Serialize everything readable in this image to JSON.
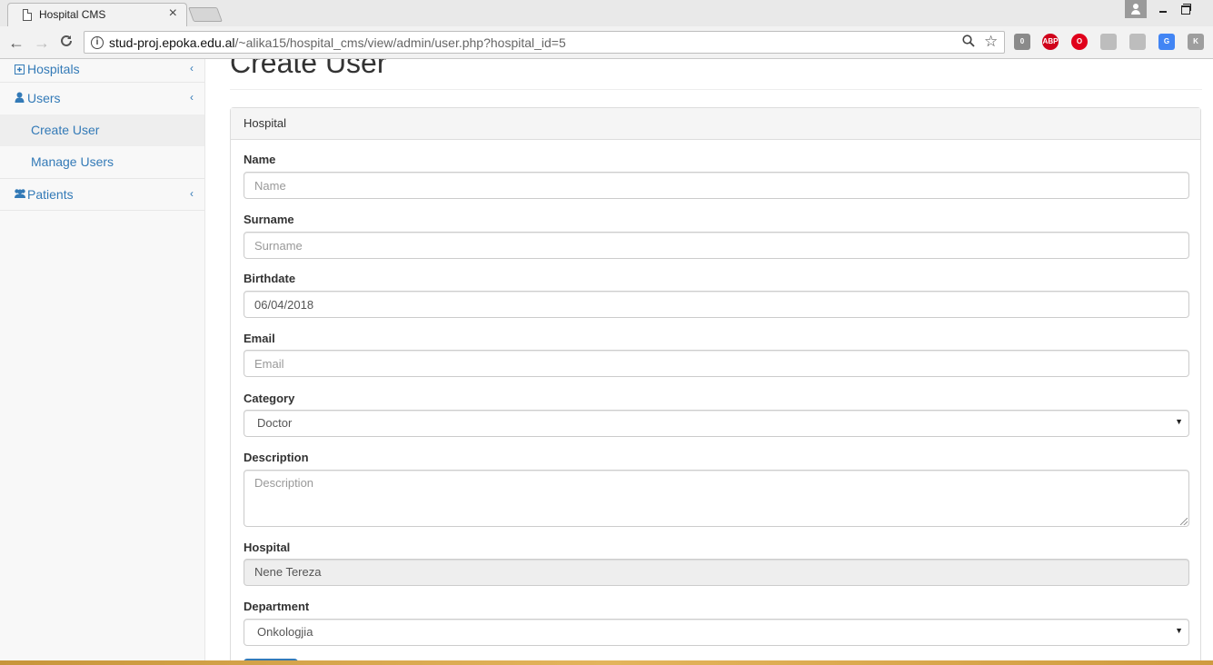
{
  "browser": {
    "tab_title": "Hospital CMS",
    "tab_close": "×",
    "url_host": "stud-proj.epoka.edu.al",
    "url_path": "/~alika15/hospital_cms/view/admin/user.php?hospital_id=5",
    "nav": {
      "back": "←",
      "forward": "→",
      "reload": "C"
    },
    "extensions": [
      {
        "name": "extension-badge-icon",
        "color": "#8a8a8a",
        "text": "0"
      },
      {
        "name": "adblock-icon",
        "color": "#d0021b",
        "text": "ABP"
      },
      {
        "name": "opera-icon",
        "color": "#e0001b",
        "text": "O"
      },
      {
        "name": "pin-icon",
        "color": "#bdbdbd",
        "text": ""
      },
      {
        "name": "pdf-icon",
        "color": "#bdbdbd",
        "text": ""
      },
      {
        "name": "translate-icon",
        "color": "#4285f4",
        "text": "G"
      },
      {
        "name": "k-extension-icon",
        "color": "#9e9e9e",
        "text": "K"
      }
    ]
  },
  "sidebar": {
    "items": [
      {
        "label": "Hospitals",
        "icon": "hospital-icon"
      },
      {
        "label": "Users",
        "icon": "user-icon"
      },
      {
        "label": "Patients",
        "icon": "users-icon"
      }
    ],
    "sub_items": [
      {
        "label": "Create User"
      },
      {
        "label": "Manage Users"
      }
    ],
    "chevron": "‹"
  },
  "main": {
    "title": "Create User",
    "panel_heading": "Hospital",
    "form": {
      "name_label": "Name",
      "name_placeholder": "Name",
      "surname_label": "Surname",
      "surname_placeholder": "Surname",
      "birthdate_label": "Birthdate",
      "birthdate_value": "06/04/2018",
      "email_label": "Email",
      "email_placeholder": "Email",
      "category_label": "Category",
      "category_value": "Doctor",
      "description_label": "Description",
      "description_placeholder": "Description",
      "hospital_label": "Hospital",
      "hospital_value": "Nene Tereza",
      "department_label": "Department",
      "department_value": "Onkologjia"
    }
  },
  "colors": {
    "link": "#337ab7",
    "primary": "#337ab7"
  }
}
